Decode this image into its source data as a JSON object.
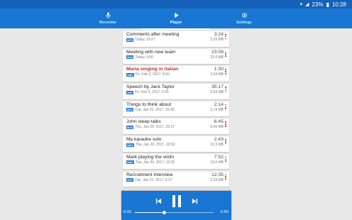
{
  "status": {
    "battery": "23%",
    "time": "10:28"
  },
  "tabs": [
    {
      "label": "Recorder",
      "icon": "mic-icon"
    },
    {
      "label": "Player",
      "icon": "play-icon"
    },
    {
      "label": "Settings",
      "icon": "gear-icon"
    }
  ],
  "recordings": [
    {
      "title": "Comments after meeting",
      "duration": "3:24",
      "format": "MP3",
      "date": "Today, 10:27",
      "size": "3.29 MB",
      "highlight": false
    },
    {
      "title": "Meeting with new team",
      "duration": "23:08",
      "format": "M4A",
      "date": "Today, 9:50",
      "size": "22.6 MB",
      "highlight": false
    },
    {
      "title": "Maria singing in italian",
      "duration": "1:30",
      "format": "WAV",
      "date": "Fri, Feb 3, 2017, 8:03",
      "size": "2.03 MB",
      "highlight": true
    },
    {
      "title": "Speech by Jack Taylor",
      "duration": "35:17",
      "format": "3GP",
      "date": "Fri, Feb 3, 2017, 6:25",
      "size": "6.53 MB",
      "highlight": false
    },
    {
      "title": "Things to think about",
      "duration": "2:14",
      "format": "MP3",
      "date": "Tue, Jan 31, 2017, 16:43",
      "size": "2.19 MB",
      "highlight": false
    },
    {
      "title": "John sleep talks",
      "duration": "6:45",
      "format": "M4A",
      "date": "Thu, Jan 26, 2017, 22:17",
      "size": "6.59 MB",
      "highlight": false
    },
    {
      "title": "My karaoke solo",
      "duration": "2:43",
      "format": "WAV",
      "date": "Thu, Jan 26, 2017, 20:53",
      "size": "10.3 MB",
      "highlight": false
    },
    {
      "title": "Mark playing the violin",
      "duration": "7:52",
      "format": "WAV",
      "date": "Tue, Jan 24, 2017, 13:26",
      "size": "13.0 MB",
      "highlight": false
    },
    {
      "title": "Recruitment interview",
      "duration": "12:35",
      "format": "3GP",
      "date": "Tue, Jan 22, 2017, 5:37",
      "size": "2.33 MB",
      "highlight": false
    }
  ],
  "player": {
    "elapsed": "0:33",
    "remaining": "-0:56",
    "progress": 0.37
  },
  "colors": {
    "accent": "#1976d2",
    "highlight": "#c62828"
  }
}
